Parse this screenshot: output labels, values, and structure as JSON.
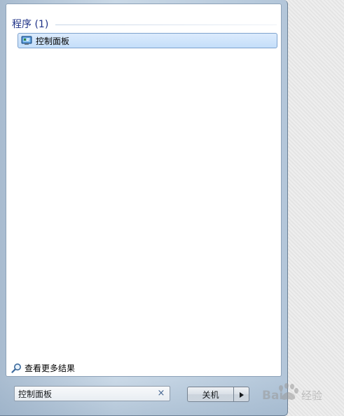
{
  "results": {
    "group_title": "程序 (1)",
    "items": [
      {
        "label": "控制面板",
        "icon": "control-panel-icon",
        "selected": true
      }
    ]
  },
  "more_results": {
    "label": "查看更多结果",
    "icon": "search-icon"
  },
  "search": {
    "value": "控制面板",
    "clear_glyph": "×"
  },
  "shutdown": {
    "label": "关机",
    "arrow_icon": "arrow-right-icon"
  },
  "watermark": {
    "text": "Baidu经验"
  },
  "colors": {
    "group_title": "#1e3287",
    "selection_fill": "#c4defa",
    "selection_border": "#7da2ce"
  }
}
